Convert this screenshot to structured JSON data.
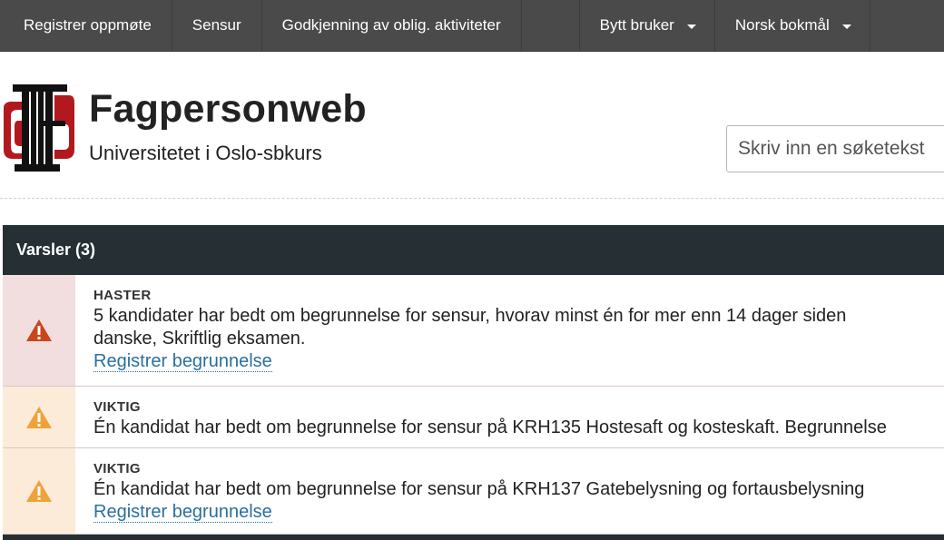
{
  "nav": {
    "register_attendance": "Registrer oppmøte",
    "grading": "Sensur",
    "approval": "Godkjenning av oblig. aktiviteter",
    "switch_user": "Bytt bruker",
    "language": "Norsk bokmål"
  },
  "header": {
    "title": "Fagpersonweb",
    "subtitle": "Universitetet i Oslo-sbkurs",
    "search_placeholder": "Skriv inn en søketekst"
  },
  "alerts": {
    "heading": "Varsler (3)",
    "items": [
      {
        "level": "HASTER",
        "message_line1": "5 kandidater har bedt om begrunnelse for sensur, hvorav minst én for mer enn 14 dager siden",
        "message_line2": "danske, Skriftlig eksamen.",
        "link": "Registrer begrunnelse"
      },
      {
        "level": "VIKTIG",
        "message_line1": "Én kandidat har bedt om begrunnelse for sensur på KRH135 Hostesaft og kosteskaft. Begrunnelse",
        "link": ""
      },
      {
        "level": "VIKTIG",
        "message_line1": "Én kandidat har bedt om begrunnelse for sensur på KRH137 Gatebelysning og fortausbelysning",
        "link": "Registrer begrunnelse"
      }
    ]
  },
  "colors": {
    "nav_bg": "#4a4a4a",
    "panel_header_bg": "#263034",
    "urgent_bg": "#f2dede",
    "important_bg": "#fcebd9",
    "urgent_icon": "#c9461a",
    "important_icon": "#f0a23a",
    "link": "#2a6fa0"
  },
  "icons": {
    "logo": "fs-logo",
    "alert": "warning-triangle-icon"
  }
}
